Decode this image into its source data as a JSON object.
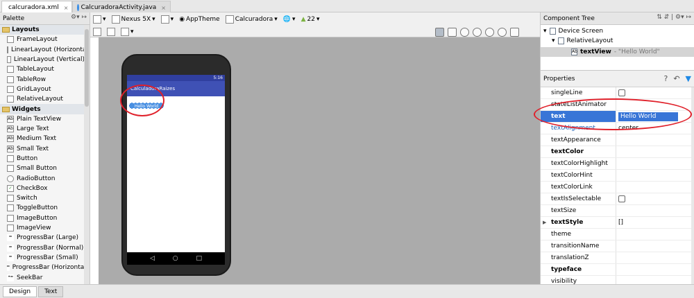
{
  "editor_tabs": [
    {
      "label": "calcuradora.xml",
      "active": true
    },
    {
      "label": "CalcuradoraActivity.java",
      "active": false
    }
  ],
  "palette": {
    "title": "Palette",
    "groups": [
      {
        "label": "Layouts",
        "items": [
          "FrameLayout",
          "LinearLayout (Horizontal)",
          "LinearLayout (Vertical)",
          "TableLayout",
          "TableRow",
          "GridLayout",
          "RelativeLayout"
        ]
      },
      {
        "label": "Widgets",
        "items": [
          "Plain TextView",
          "Large Text",
          "Medium Text",
          "Small Text",
          "Button",
          "Small Button",
          "RadioButton",
          "CheckBox",
          "Switch",
          "ToggleButton",
          "ImageButton",
          "ImageView",
          "ProgressBar (Large)",
          "ProgressBar (Normal)",
          "ProgressBar (Small)",
          "ProgressBar (Horizontal)",
          "SeekBar"
        ]
      }
    ]
  },
  "toolbar": {
    "device": "Nexus 5X",
    "theme": "AppTheme",
    "activity": "Calcuradora",
    "api": "22"
  },
  "preview": {
    "status_time": "5:16",
    "app_title": "CalculadoraRaizes",
    "textview_text": "Hello World"
  },
  "component_tree": {
    "title": "Component Tree",
    "nodes": [
      {
        "label": "Device Screen"
      },
      {
        "label": "RelativeLayout"
      },
      {
        "label": "textView",
        "detail": "- \"Hello World\""
      }
    ]
  },
  "properties": {
    "title": "Properties",
    "rows": [
      {
        "name": "singleLine",
        "value": "",
        "type": "checkbox"
      },
      {
        "name": "stateListAnimator",
        "value": ""
      },
      {
        "name": "text",
        "value": "Hello World",
        "selected": true
      },
      {
        "name": "textAlignment",
        "value": "center"
      },
      {
        "name": "textAppearance",
        "value": ""
      },
      {
        "name": "textColor",
        "value": "",
        "bold": true
      },
      {
        "name": "textColorHighlight",
        "value": ""
      },
      {
        "name": "textColorHint",
        "value": ""
      },
      {
        "name": "textColorLink",
        "value": ""
      },
      {
        "name": "textIsSelectable",
        "value": "",
        "type": "checkbox"
      },
      {
        "name": "textSize",
        "value": ""
      },
      {
        "name": "textStyle",
        "value": "[]",
        "bold": true,
        "expandable": true
      },
      {
        "name": "theme",
        "value": ""
      },
      {
        "name": "transitionName",
        "value": ""
      },
      {
        "name": "translationZ",
        "value": ""
      },
      {
        "name": "typeface",
        "value": "",
        "bold": true
      },
      {
        "name": "visibility",
        "value": ""
      }
    ]
  },
  "bottom_tabs": [
    {
      "label": "Design",
      "active": true
    },
    {
      "label": "Text",
      "active": false
    }
  ],
  "colors": {
    "accent": "#3875d7",
    "annotation_red": "#e0202a",
    "app_bar": "#3f51b5"
  }
}
